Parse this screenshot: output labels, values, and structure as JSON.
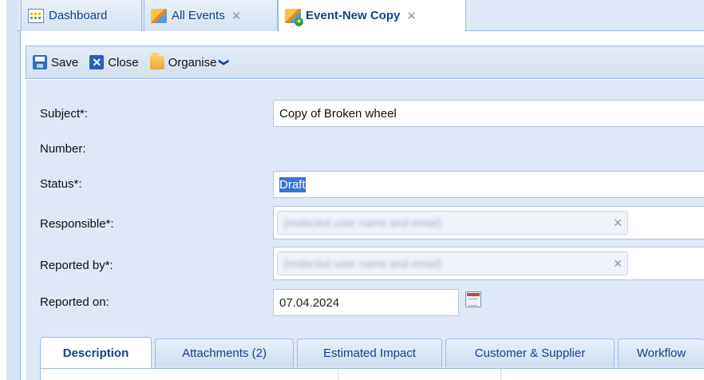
{
  "tabs": [
    {
      "label": "Dashboard",
      "icon": "dashboard-icon",
      "closable": false
    },
    {
      "label": "All Events",
      "icon": "events-icon",
      "closable": true
    },
    {
      "label": "Event-New Copy",
      "icon": "event-new-icon",
      "closable": true,
      "active": true
    }
  ],
  "tab_close_glyph": "✕",
  "toolbar": {
    "save_label": "Save",
    "close_label": "Close",
    "organise_label": "Organise",
    "close_icon_glyph": "✕",
    "organise_chevron": "❯"
  },
  "form": {
    "subject_label": "Subject*:",
    "subject_value": "Copy of Broken wheel",
    "number_label": "Number:",
    "status_label": "Status*:",
    "status_value": "Draft",
    "responsible_label": "Responsible*:",
    "responsible_value": "[redacted user name and email]",
    "reported_by_label": "Reported by*:",
    "reported_by_value": "[redacted user name and email]",
    "reported_on_label": "Reported on:",
    "reported_on_value": "07.04.2024",
    "token_remove_glyph": "✕"
  },
  "subtabs": [
    {
      "label": "Description",
      "active": true
    },
    {
      "label": "Attachments (2)"
    },
    {
      "label": "Estimated Impact"
    },
    {
      "label": "Customer & Supplier"
    },
    {
      "label": "Workflow"
    }
  ],
  "colors": {
    "panel_bg": "#dfe8f6",
    "border": "#99bbe8",
    "tab_text": "#15428b",
    "selection": "#3875d7"
  }
}
